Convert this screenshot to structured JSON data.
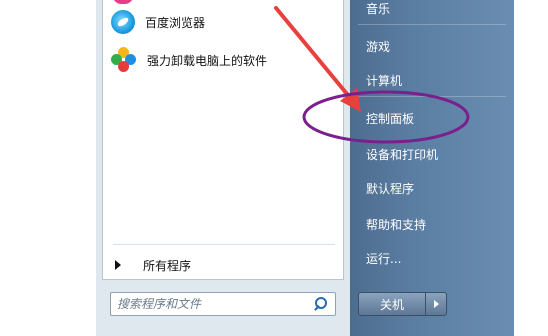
{
  "programs": [
    {
      "label": "百度浏览器",
      "icon": "baidu-browser-icon"
    },
    {
      "label": "强力卸载电脑上的软件",
      "icon": "uninstall-icon"
    }
  ],
  "all_programs": {
    "label": "所有程序",
    "icon": "arrow-right-icon"
  },
  "search": {
    "placeholder": "搜索程序和文件",
    "icon": "search-icon"
  },
  "right_items": [
    {
      "label": "音乐"
    },
    {
      "label": "游戏"
    },
    {
      "label": "计算机"
    },
    {
      "label": "控制面板"
    },
    {
      "label": "设备和打印机"
    },
    {
      "label": "默认程序"
    },
    {
      "label": "帮助和支持"
    },
    {
      "label": "运行..."
    }
  ],
  "shutdown": {
    "label": "关机",
    "more_icon": "arrow-right-icon"
  },
  "annotation": {
    "arrow_color": "#e8403c",
    "ellipse_color": "#7a1f8c",
    "highlight_target": "控制面板"
  }
}
